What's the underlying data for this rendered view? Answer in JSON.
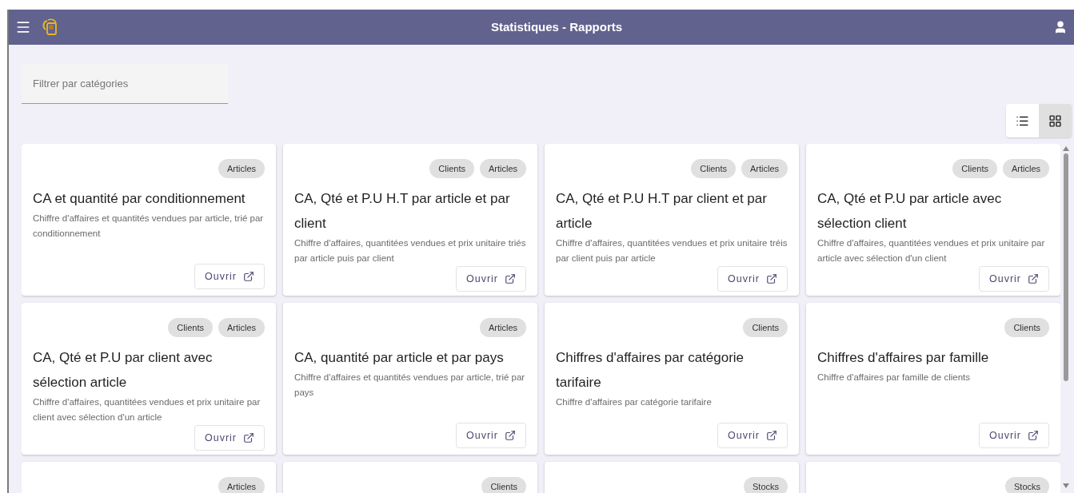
{
  "header": {
    "title": "Statistiques - Rapports"
  },
  "filter": {
    "placeholder": "Filtrer par catégories"
  },
  "view_toggle": [
    {
      "kind": "list",
      "selected": false
    },
    {
      "kind": "grid",
      "selected": true
    }
  ],
  "cards": [
    {
      "tags": [
        "Articles"
      ],
      "title": "CA et quantité par conditionnement",
      "description": "Chiffre d'affaires et quantités vendues par article, trié par conditionnement",
      "button": "Ouvrir"
    },
    {
      "tags": [
        "Clients",
        "Articles"
      ],
      "title": "CA, Qté et P.U H.T par article et par client",
      "description": "Chiffre d'affaires, quantitées vendues et prix unitaire triés par article puis par client",
      "button": "Ouvrir"
    },
    {
      "tags": [
        "Clients",
        "Articles"
      ],
      "title": "CA, Qté et P.U H.T par client et par article",
      "description": "Chiffre d'affaires, quantitées vendues et prix unitaire tréis par client puis par article",
      "button": "Ouvrir"
    },
    {
      "tags": [
        "Clients",
        "Articles"
      ],
      "title": "CA, Qté et P.U par article avec sélection client",
      "description": "Chiffre d'affaires, quantitées vendues et prix unitaire par article avec sélection d'un client",
      "button": "Ouvrir"
    },
    {
      "tags": [
        "Clients",
        "Articles"
      ],
      "title": "CA, Qté et P.U par client avec sélection article",
      "description": "Chiffre d'affaires, quantitées vendues et prix unitaire par client avec sélection d'un article",
      "button": "Ouvrir"
    },
    {
      "tags": [
        "Articles"
      ],
      "title": "CA, quantité par article et par pays",
      "description": "Chiffre d'affaires et quantités vendues par article, trié par pays",
      "button": "Ouvrir"
    },
    {
      "tags": [
        "Clients"
      ],
      "title": "Chiffres d'affaires par catégorie tarifaire",
      "description": "Chiffre d'affaires par catégorie tarifaire",
      "button": "Ouvrir"
    },
    {
      "tags": [
        "Clients"
      ],
      "title": "Chiffres d'affaires par famille",
      "description": "Chiffre d'affaires par famille de clients",
      "button": "Ouvrir"
    },
    {
      "tags": [
        "Articles"
      ]
    },
    {
      "tags": [
        "Clients"
      ]
    },
    {
      "tags": [
        "Stocks"
      ]
    },
    {
      "tags": [
        "Stocks"
      ]
    }
  ]
}
